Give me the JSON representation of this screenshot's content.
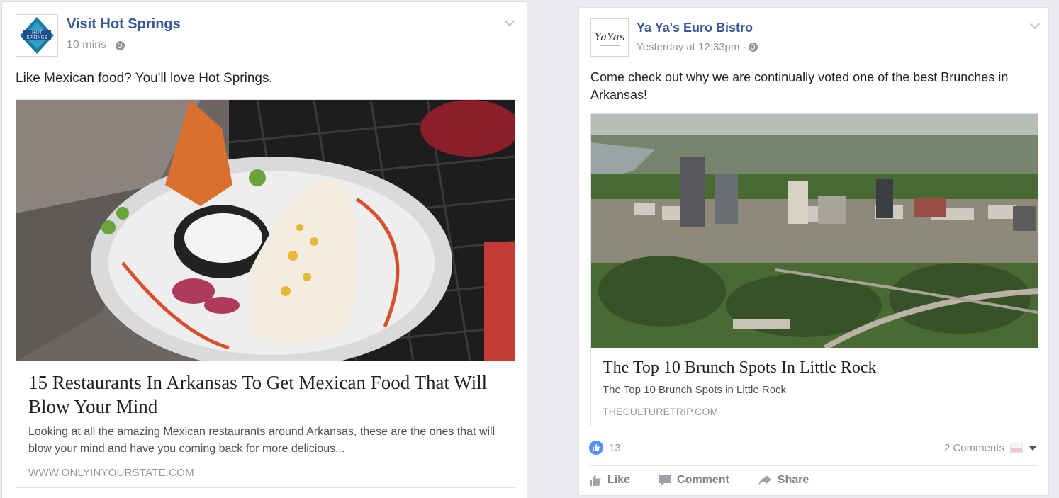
{
  "posts": [
    {
      "page_name": "Visit Hot Springs",
      "time": "10 mins",
      "separator": "·",
      "avatar_text": "HOT SPRINGS",
      "text": "Like Mexican food? You'll love Hot Springs.",
      "link": {
        "title": "15 Restaurants In Arkansas To Get Mexican Food That Will Blow Your Mind",
        "description": "Looking at all the amazing Mexican restaurants around Arkansas, these are the ones that will blow your mind and have you coming back for more delicious...",
        "domain": "WWW.ONLYINYOURSTATE.COM"
      }
    },
    {
      "page_name": "Ya Ya's Euro Bistro",
      "time": "Yesterday at 12:33pm",
      "separator": "·",
      "avatar_text": "YaYas",
      "text": "Come check out why we are continually voted one of the best Brunches in Arkansas!",
      "link": {
        "title": "The Top 10 Brunch Spots In Little Rock",
        "description": "The Top 10 Brunch Spots in Little Rock",
        "domain": "THECULTURETRIP.COM"
      },
      "reactions_count": "13",
      "comments": "2 Comments",
      "actions": {
        "like": "Like",
        "comment": "Comment",
        "share": "Share"
      }
    }
  ],
  "colors": {
    "link_blue": "#365899",
    "meta_gray": "#90949c",
    "like_blue": "#5890ff",
    "page_bg": "#e9ebee"
  }
}
